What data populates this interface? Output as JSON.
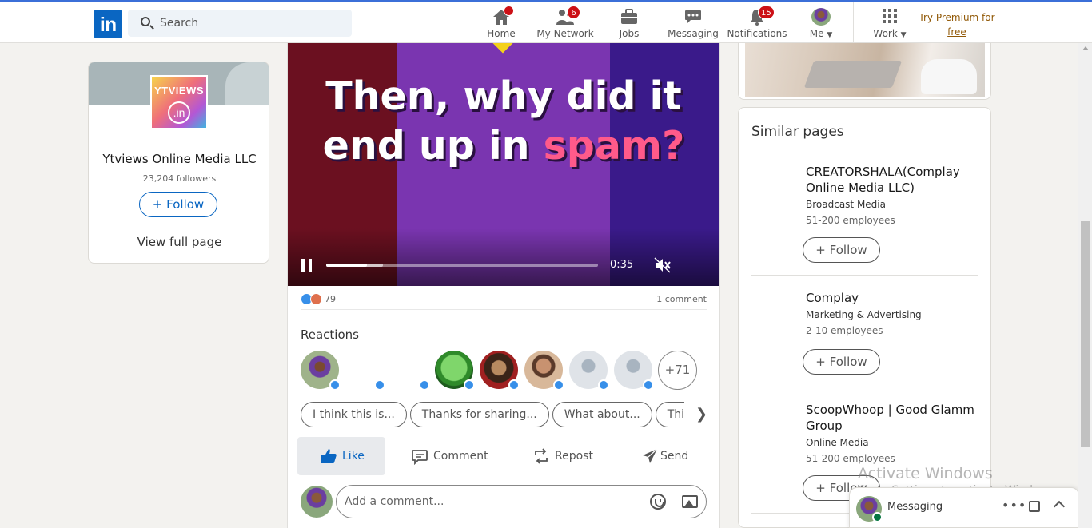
{
  "nav": {
    "logo": "in",
    "search_placeholder": "Search",
    "items": [
      {
        "label": "Home",
        "icon": "home-icon",
        "badge": ""
      },
      {
        "label": "My Network",
        "icon": "network-icon",
        "badge": "6"
      },
      {
        "label": "Jobs",
        "icon": "briefcase-icon",
        "badge": ""
      },
      {
        "label": "Messaging",
        "icon": "messaging-icon",
        "badge": ""
      },
      {
        "label": "Notifications",
        "icon": "bell-icon",
        "badge": "15"
      },
      {
        "label": "Me",
        "icon": "avatar",
        "badge": ""
      },
      {
        "label": "Work",
        "icon": "grid-icon",
        "badge": ""
      }
    ],
    "premium_line1": "Try Premium for",
    "premium_line2": "free"
  },
  "company_card": {
    "logo_text1": "YTVIEWS",
    "logo_text2": ".in",
    "name": "Ytviews Online Media LLC",
    "followers": "23,204 followers",
    "follow_label": "Follow",
    "view_full_page": "View full page"
  },
  "video": {
    "text_line1": "Then, why did it",
    "text_line2_a": "end up in ",
    "text_line2_b": "spam?",
    "time": "0:35",
    "played_fraction": 0.15,
    "buffered_fraction": 0.21
  },
  "post": {
    "reaction_count": "79",
    "comment_count": "1 comment",
    "reactions_title": "Reactions",
    "more_reactors": "+71",
    "suggestions": [
      "I think this is...",
      "Thanks for sharing...",
      "What about...",
      "This will"
    ],
    "actions": {
      "like": "Like",
      "comment": "Comment",
      "repost": "Repost",
      "send": "Send"
    },
    "comment_placeholder": "Add a comment..."
  },
  "similar_pages": {
    "title": "Similar pages",
    "pages": [
      {
        "name": "CREATORSHALA(Complay Online Media LLC)",
        "industry": "Broadcast Media",
        "employees": "51-200 employees",
        "follow": "Follow"
      },
      {
        "name": "Complay",
        "industry": "Marketing & Advertising",
        "employees": "2-10 employees",
        "follow": "Follow"
      },
      {
        "name": "ScoopWhoop | Good Glamm Group",
        "industry": "Online Media",
        "employees": "51-200 employees",
        "follow": "Follow"
      }
    ]
  },
  "windows_watermark": {
    "line1": "Activate Windows",
    "line2": "Go to Settings to activate Windows."
  },
  "messaging_bar": {
    "label": "Messaging"
  },
  "colors": {
    "brand": "#0a66c2",
    "badge": "#cc1016",
    "premium": "#915907"
  }
}
